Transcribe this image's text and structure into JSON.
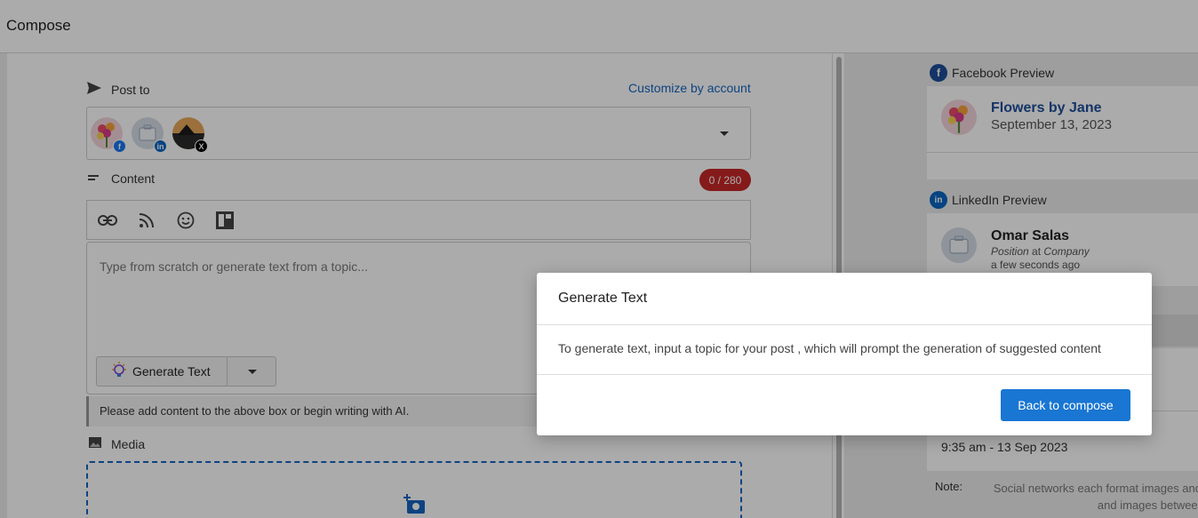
{
  "header": {
    "title": "Compose"
  },
  "compose": {
    "post_to_label": "Post to",
    "customize_link": "Customize by account",
    "accounts": [
      {
        "network": "facebook",
        "badge": "f",
        "badge_color": "#1877f2"
      },
      {
        "network": "linkedin",
        "badge": "in",
        "badge_color": "#0a66c2"
      },
      {
        "network": "x",
        "badge": "X",
        "badge_color": "#000000"
      }
    ],
    "content_label": "Content",
    "char_counter": "0 / 280",
    "toolbar_icons": [
      "link-icon",
      "rss-icon",
      "emoji-icon",
      "layout-icon"
    ],
    "editor_placeholder": "Type from scratch or generate text from a topic...",
    "generate_button": "Generate Text",
    "hint": "Please add content to the above box or begin writing with AI.",
    "media_label": "Media"
  },
  "preview": {
    "facebook_label": "Facebook Preview",
    "facebook_name": "Flowers by Jane",
    "facebook_date": "September 13, 2023",
    "linkedin_label": "LinkedIn Preview",
    "linkedin_name": "Omar Salas",
    "linkedin_position": "Position",
    "linkedin_at": "at",
    "linkedin_company": "Company",
    "linkedin_time": "a few seconds ago",
    "schedule_time": "9:35 am - 13 Sep 2023",
    "note_label": "Note:",
    "note_line1": "Social networks each format images and",
    "note_line2": "and images betweer"
  },
  "modal": {
    "title": "Generate Text",
    "body": "To generate text, input a topic for your post , which will prompt the generation of suggested content",
    "button": "Back to compose"
  },
  "colors": {
    "accent": "#1976d2",
    "link": "#1565c0",
    "counter_bg": "#c62828",
    "facebook": "#1877f2",
    "linkedin": "#0a66c2"
  }
}
